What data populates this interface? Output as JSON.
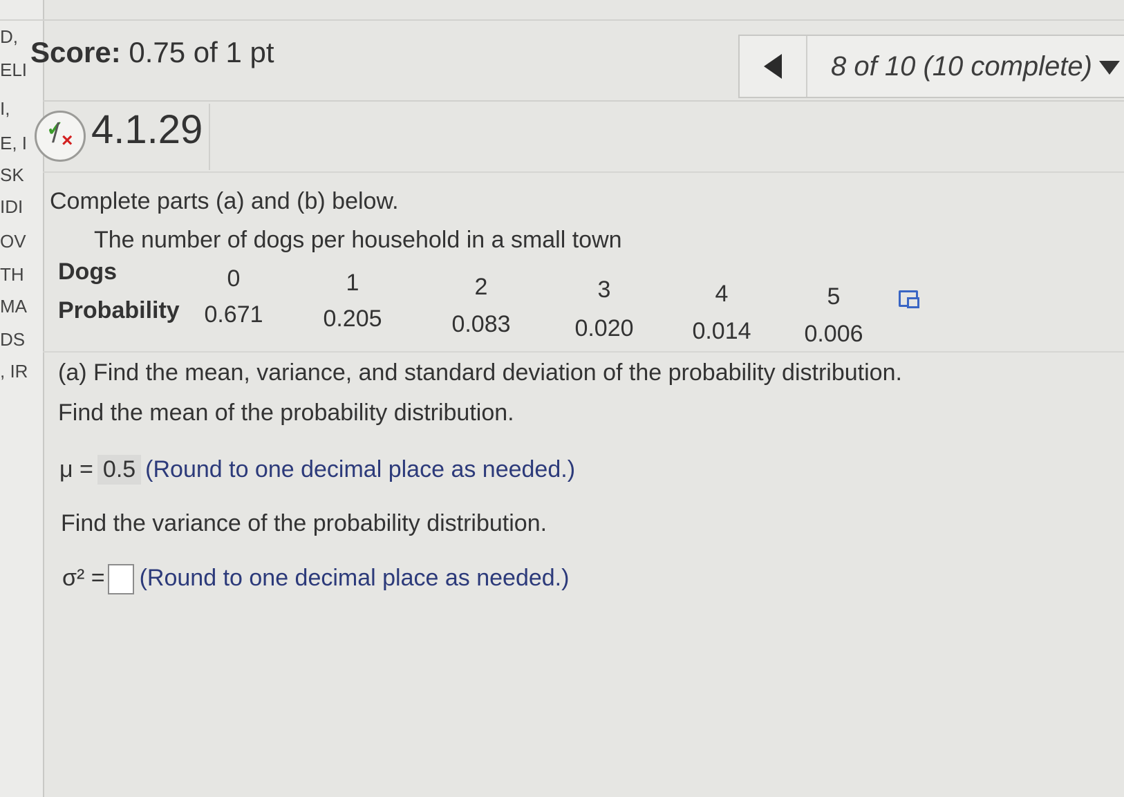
{
  "left_strip": [
    "D,",
    "ELI",
    "I,",
    "E, I",
    "SK",
    "IDI",
    "OV",
    "TH",
    "MA",
    "DS",
    ", IR"
  ],
  "header": {
    "score_label": "Score:",
    "score_value": "0.75 of 1 pt",
    "progress": "8 of 10 (10 complete)"
  },
  "question": {
    "id": "4.1.29",
    "intro": "Complete parts (a) and (b) below.",
    "table_title": "The number of dogs per household in a small town",
    "row1_label": "Dogs",
    "row2_label": "Probability",
    "dogs": [
      "0",
      "1",
      "2",
      "3",
      "4",
      "5"
    ],
    "probabilities": [
      "0.671",
      "0.205",
      "0.083",
      "0.020",
      "0.014",
      "0.006"
    ],
    "part_a": "(a) Find the mean, variance, and standard deviation of the probability distribution.",
    "mean_prompt": "Find the mean of the probability distribution.",
    "mu_symbol": "μ =",
    "mu_value": "0.5",
    "mu_hint": "(Round to one decimal place as needed.)",
    "variance_prompt": "Find the variance of the probability distribution.",
    "sigma_symbol": "σ² =",
    "variance_value": "",
    "variance_hint": "(Round to one decimal place as needed.)"
  },
  "colors": {
    "background": "#e6e6e3",
    "hint_text": "#2c3a7a",
    "check_green": "#3a9b2a",
    "x_red": "#d32020",
    "popout_blue": "#3a66c4"
  },
  "icons": [
    "chevron-left-icon",
    "chevron-down-icon",
    "partial-credit-icon",
    "popout-icon"
  ]
}
